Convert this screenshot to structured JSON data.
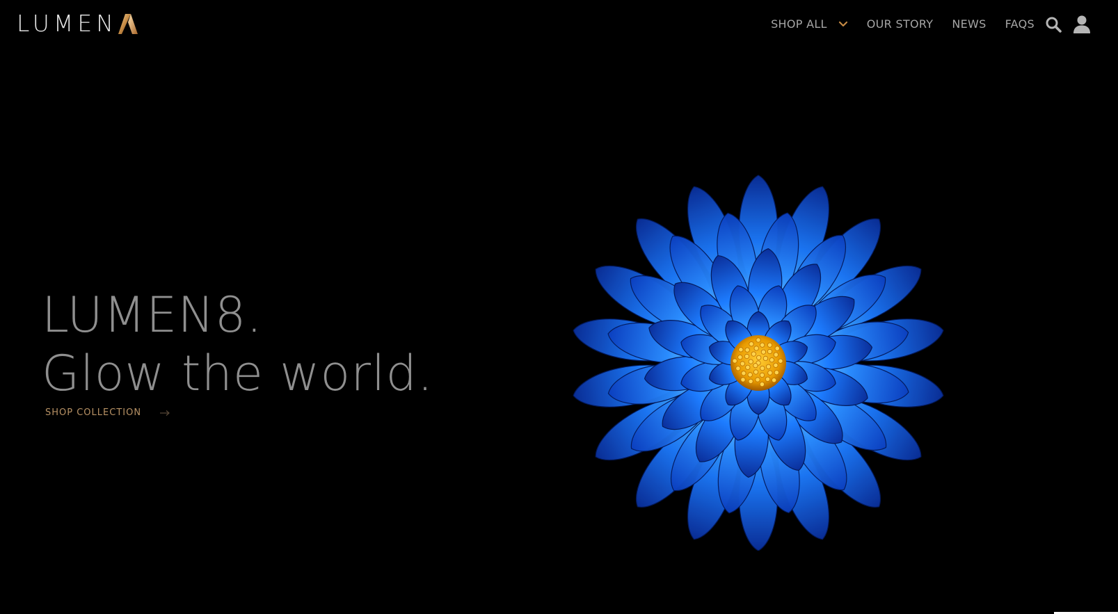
{
  "brand": {
    "logo_text": "LUMEN",
    "logo_mark_icon": "gold-triangle-a-mark",
    "accent_color": "#c58a44"
  },
  "nav": {
    "items": [
      {
        "label": "SHOP ALL",
        "has_dropdown": true
      },
      {
        "label": "OUR STORY"
      },
      {
        "label": "NEWS"
      },
      {
        "label": "FAQS"
      }
    ],
    "search_icon": "search-icon",
    "account_icon": "user-icon",
    "chevron_color": "#c58a44"
  },
  "hero": {
    "headline_line1": "LUMEN8.",
    "headline_line2": "Glow the world.",
    "cta_label": "SHOP COLLECTION",
    "cta_icon": "arrow-right-icon",
    "image": "blue-dahlia-flower"
  },
  "colors": {
    "background": "#000000",
    "headline": "#8f8f8f",
    "cta": "#b89265",
    "nav_text": "#a6a6a6",
    "flower_blue": "#1a7cff",
    "flower_center": "#f0a500"
  }
}
